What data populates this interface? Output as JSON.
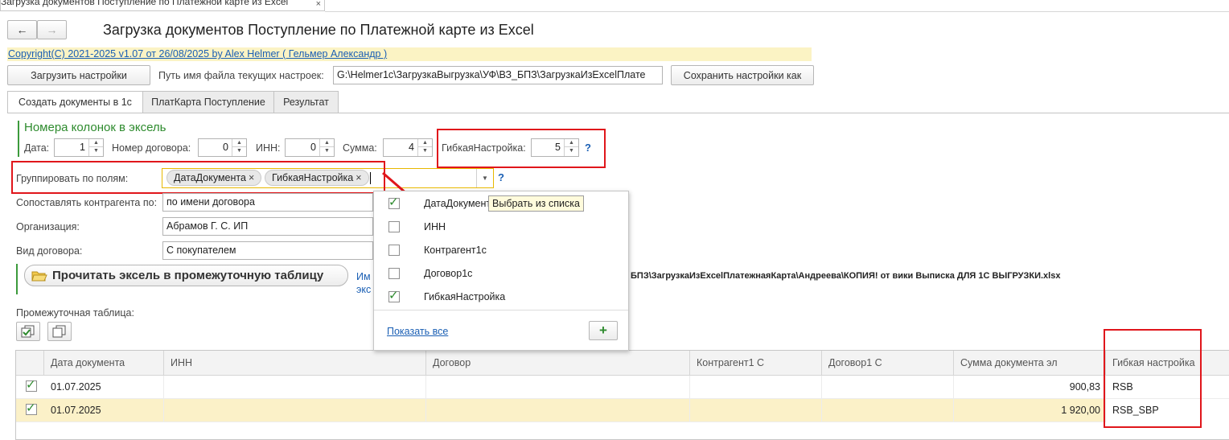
{
  "window_tab": {
    "title": "Загрузка документов Поступление по Платежной карте из Excel",
    "close": "×"
  },
  "nav": {
    "back": "←",
    "forward": "→"
  },
  "page_title": "Загрузка документов Поступление по Платежной карте из Excel",
  "copyright": "Copyright(C)  2021-2025 v1.07 от 26/08/2025  by Alex Helmer ( Гельмер Александр  )",
  "toolbar": {
    "load_settings": "Загрузить настройки",
    "path_label": "Путь имя файла текущих настроек:",
    "path_value": "G:\\Helmer1c\\ЗагрузкаВыгрузка\\УФ\\ВЗ_БПЗ\\ЗагрузкаИзExcelПлате",
    "save_settings_as": "Сохранить настройки как"
  },
  "tabs": [
    "Создать документы в 1с",
    "ПлатКарта Поступление",
    "Результат"
  ],
  "columns_section": {
    "header": "Номера колонок в эксель",
    "date_label": "Дата:",
    "date_value": "1",
    "contract_label": "Номер договора:",
    "contract_value": "0",
    "inn_label": "ИНН:",
    "inn_value": "0",
    "sum_label": "Сумма:",
    "sum_value": "4",
    "flex_label": "ГибкаяНастройка:",
    "flex_value": "5",
    "help": "?"
  },
  "group_by": {
    "label": "Группировать по полям:",
    "tags": [
      "ДатаДокумента",
      "ГибкаяНастройка"
    ],
    "tag_remove": "×",
    "help": "?"
  },
  "match_counterparty": {
    "label": "Сопоставлять контрагента по:",
    "value": "по имени договора"
  },
  "organization": {
    "label": "Организация:",
    "value": "Абрамов Г. С. ИП"
  },
  "contract_type": {
    "label": "Вид договора:",
    "value": "С покупателем"
  },
  "read_excel_button": "Прочитать эксель в промежуточную таблицу",
  "file_info": {
    "prefix1": "Им",
    "prefix2": "экс",
    "path": "БПЗ\\ЗагрузкаИзExcelПлатежнаяКарта\\Андреева\\КОПИЯ! от вики Выписка ДЛЯ 1С ВЫГРУЗКИ.xlsx"
  },
  "intermediate_label": "Промежуточная таблица:",
  "dropdown": {
    "items": [
      {
        "label": "ДатаДокумент",
        "checked": true
      },
      {
        "label": "ИНН",
        "checked": false
      },
      {
        "label": "Контрагент1с",
        "checked": false
      },
      {
        "label": "Договор1с",
        "checked": false
      },
      {
        "label": "ГибкаяНастройка",
        "checked": true
      }
    ],
    "show_all": "Показать все",
    "add": "+",
    "tooltip": "Выбрать из списка"
  },
  "table": {
    "headers": [
      "Дата документа",
      "ИНН",
      "Договор",
      "Контрагент1 С",
      "Договор1 С",
      "Сумма документа эл",
      "Гибкая настройка"
    ],
    "rows": [
      {
        "checked": true,
        "date": "01.07.2025",
        "inn": "",
        "contract": "",
        "counterparty": "",
        "contract1c": "",
        "sum": "900,83",
        "flex": "RSB"
      },
      {
        "checked": true,
        "date": "01.07.2025",
        "inn": "",
        "contract": "",
        "counterparty": "",
        "contract1c": "",
        "sum": "1 920,00",
        "flex": "RSB_SBP"
      }
    ]
  },
  "colors": {
    "accent_green": "#2e8b2e",
    "highlight_yellow": "#fbf3c4",
    "annotation_red": "#e0161b",
    "link_blue": "#1a5fb4"
  }
}
